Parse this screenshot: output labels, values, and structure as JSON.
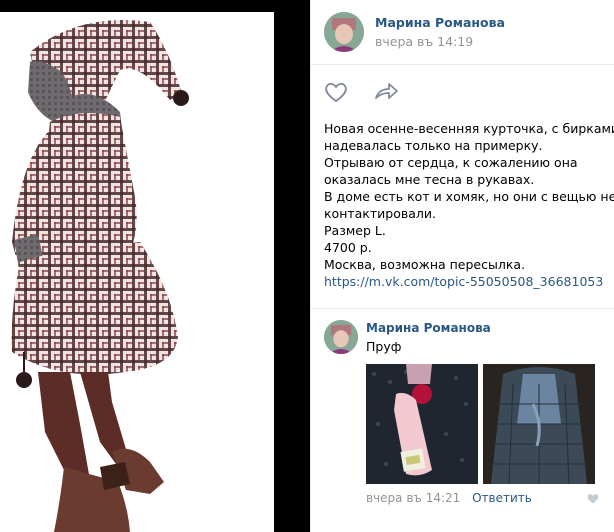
{
  "post": {
    "author": "Марина Романова",
    "date": "вчера въ 14:19",
    "text_lines": [
      "Новая осенне-весенняя курточка, с бирками,",
      "надевалась только на примерку.",
      "Отрываю от сердца, к сожалению она",
      "оказалась мне тесна в рукавах.",
      "В доме есть кот и хомяк, но они с вещью не",
      "контактировали.",
      "Размер L.",
      "4700 р.",
      "Москва, возможна пересылка."
    ],
    "link": "https://m.vk.com/topic-55050508_36681053"
  },
  "actions": {
    "like_icon": "heart-outline-icon",
    "share_icon": "share-arrow-icon"
  },
  "comment": {
    "author": "Марина Романова",
    "text": "Пруф",
    "date": "вчера въ 14:21",
    "reply_label": "Ответить",
    "like_icon": "heart-small-icon"
  },
  "colors": {
    "link": "#2a5885",
    "muted": "#939393",
    "divider": "#e7e8ec",
    "viewer_bg": "#000000"
  }
}
